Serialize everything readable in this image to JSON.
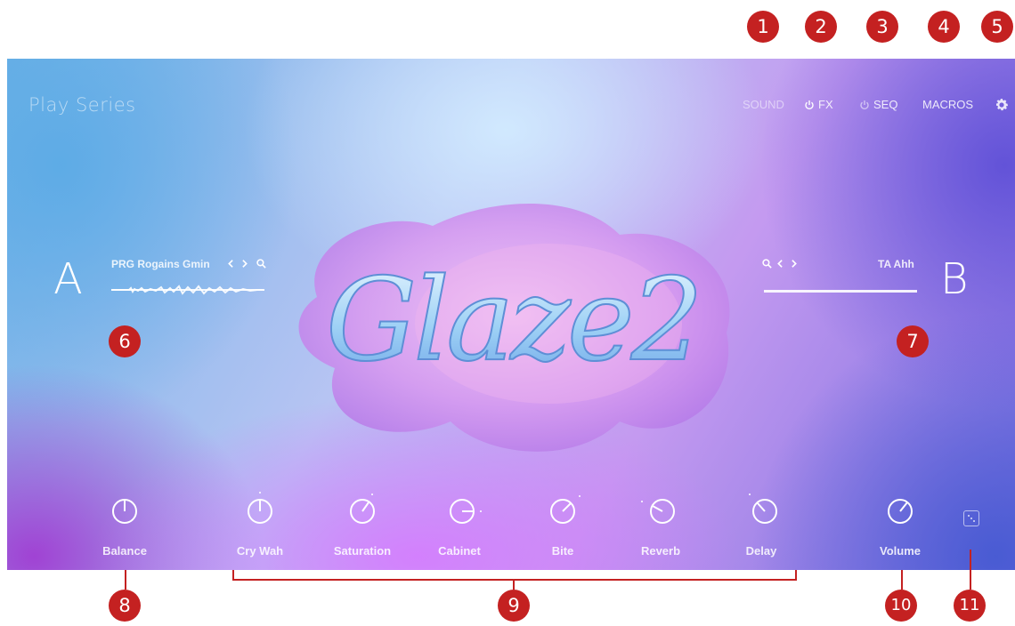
{
  "app": {
    "brand": "Play Series"
  },
  "nav": {
    "sound": "SOUND",
    "fx": "FX",
    "seq": "SEQ",
    "macros": "MACROS"
  },
  "slots": {
    "a": {
      "letter": "A",
      "preset": "PRG Rogains Gmin"
    },
    "b": {
      "letter": "B",
      "preset": "TA Ahh"
    }
  },
  "logo": {
    "text": "Glaze2"
  },
  "knobs": [
    {
      "label": "Balance",
      "value": 0.5
    },
    {
      "label": "Cry Wah",
      "value": 0.5
    },
    {
      "label": "Saturation",
      "value": 0.65
    },
    {
      "label": "Cabinet",
      "value": 0.75
    },
    {
      "label": "Bite",
      "value": 0.65
    },
    {
      "label": "Reverb",
      "value": 0.3
    },
    {
      "label": "Delay",
      "value": 0.35
    },
    {
      "label": "Volume",
      "value": 0.65
    }
  ],
  "callouts": [
    "1",
    "2",
    "3",
    "4",
    "5",
    "6",
    "7",
    "8",
    "9",
    "10",
    "11"
  ],
  "colors": {
    "callout": "#c42121",
    "text": "#ffffff"
  },
  "icons": [
    "power-icon",
    "gear-icon",
    "search-icon",
    "chevron-left-icon",
    "chevron-right-icon",
    "dice-icon"
  ]
}
